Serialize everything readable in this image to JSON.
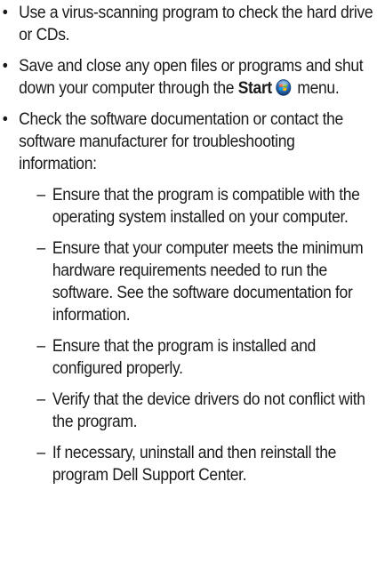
{
  "bullets": [
    {
      "text": "Use a virus-scanning program to check the hard drive or CDs."
    },
    {
      "text_before": "Save and close any open files or programs and shut down your computer through the ",
      "bold": "Start",
      "text_after": " menu.",
      "icon": "windows-start-orb-icon"
    },
    {
      "text": "Check the software documentation or contact the software manufacturer for troubleshooting information:"
    }
  ],
  "sub_items": [
    "Ensure that the program is compatible with the operating system installed on your computer.",
    "Ensure that your computer meets the minimum hardware requirements needed to run the software. See the software documentation for information.",
    "Ensure that the program is installed and configured properly.",
    "Verify that the device drivers do not conflict with the program.",
    "If necessary, uninstall and then reinstall the program Dell Support Center."
  ],
  "symbols": {
    "bullet": "•",
    "dash": "–"
  }
}
